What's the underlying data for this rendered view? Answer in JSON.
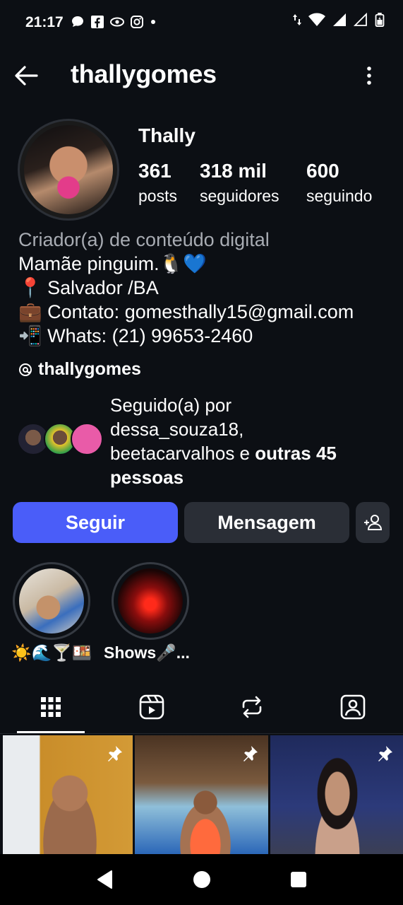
{
  "status_bar": {
    "time": "21:17",
    "icons": [
      "chat-bubble-icon",
      "facebook-icon",
      "eye-icon",
      "instagram-icon",
      "dot-icon"
    ],
    "right_icons": [
      "data-arrows-icon",
      "wifi-icon",
      "signal-icon",
      "signal-empty-icon",
      "battery-icon"
    ]
  },
  "header": {
    "username": "thallygomes",
    "back_icon": "arrow-left-icon",
    "menu_icon": "more-vertical-icon"
  },
  "profile": {
    "display_name": "Thally",
    "stats": [
      {
        "value": "361",
        "label": "posts"
      },
      {
        "value": "318 mil",
        "label": "seguidores"
      },
      {
        "value": "600",
        "label": "seguindo"
      }
    ],
    "category": "Criador(a) de conteúdo digital",
    "bio_lines": [
      "Mamãe pinguim.🐧💙",
      "📍 Salvador  /BA",
      "💼 Contato: gomesthally15@gmail.com",
      "📲 Whats: (21) 99653-2460"
    ],
    "threads_handle": "thallygomes",
    "followed_by": {
      "prefix": "Seguido(a) por",
      "names": "dessa_souza18,",
      "names2": "beetacarvalhos e",
      "others": "outras 45",
      "others2": "pessoas"
    }
  },
  "actions": {
    "follow": "Seguir",
    "message": "Mensagem",
    "add_icon": "add-person-icon"
  },
  "highlights": [
    {
      "label": "☀️🌊🍸🍱"
    },
    {
      "label": "Shows🎤..."
    }
  ],
  "tabs": [
    "grid-icon",
    "reels-icon",
    "reposts-icon",
    "tagged-icon"
  ],
  "grid": [
    {
      "pinned": true
    },
    {
      "pinned": true
    },
    {
      "pinned": true
    }
  ],
  "colors": {
    "background": "#0c0f14",
    "follow_button": "#4a5df9",
    "secondary_button": "#2a2e36",
    "category_text": "#a8acb3"
  }
}
